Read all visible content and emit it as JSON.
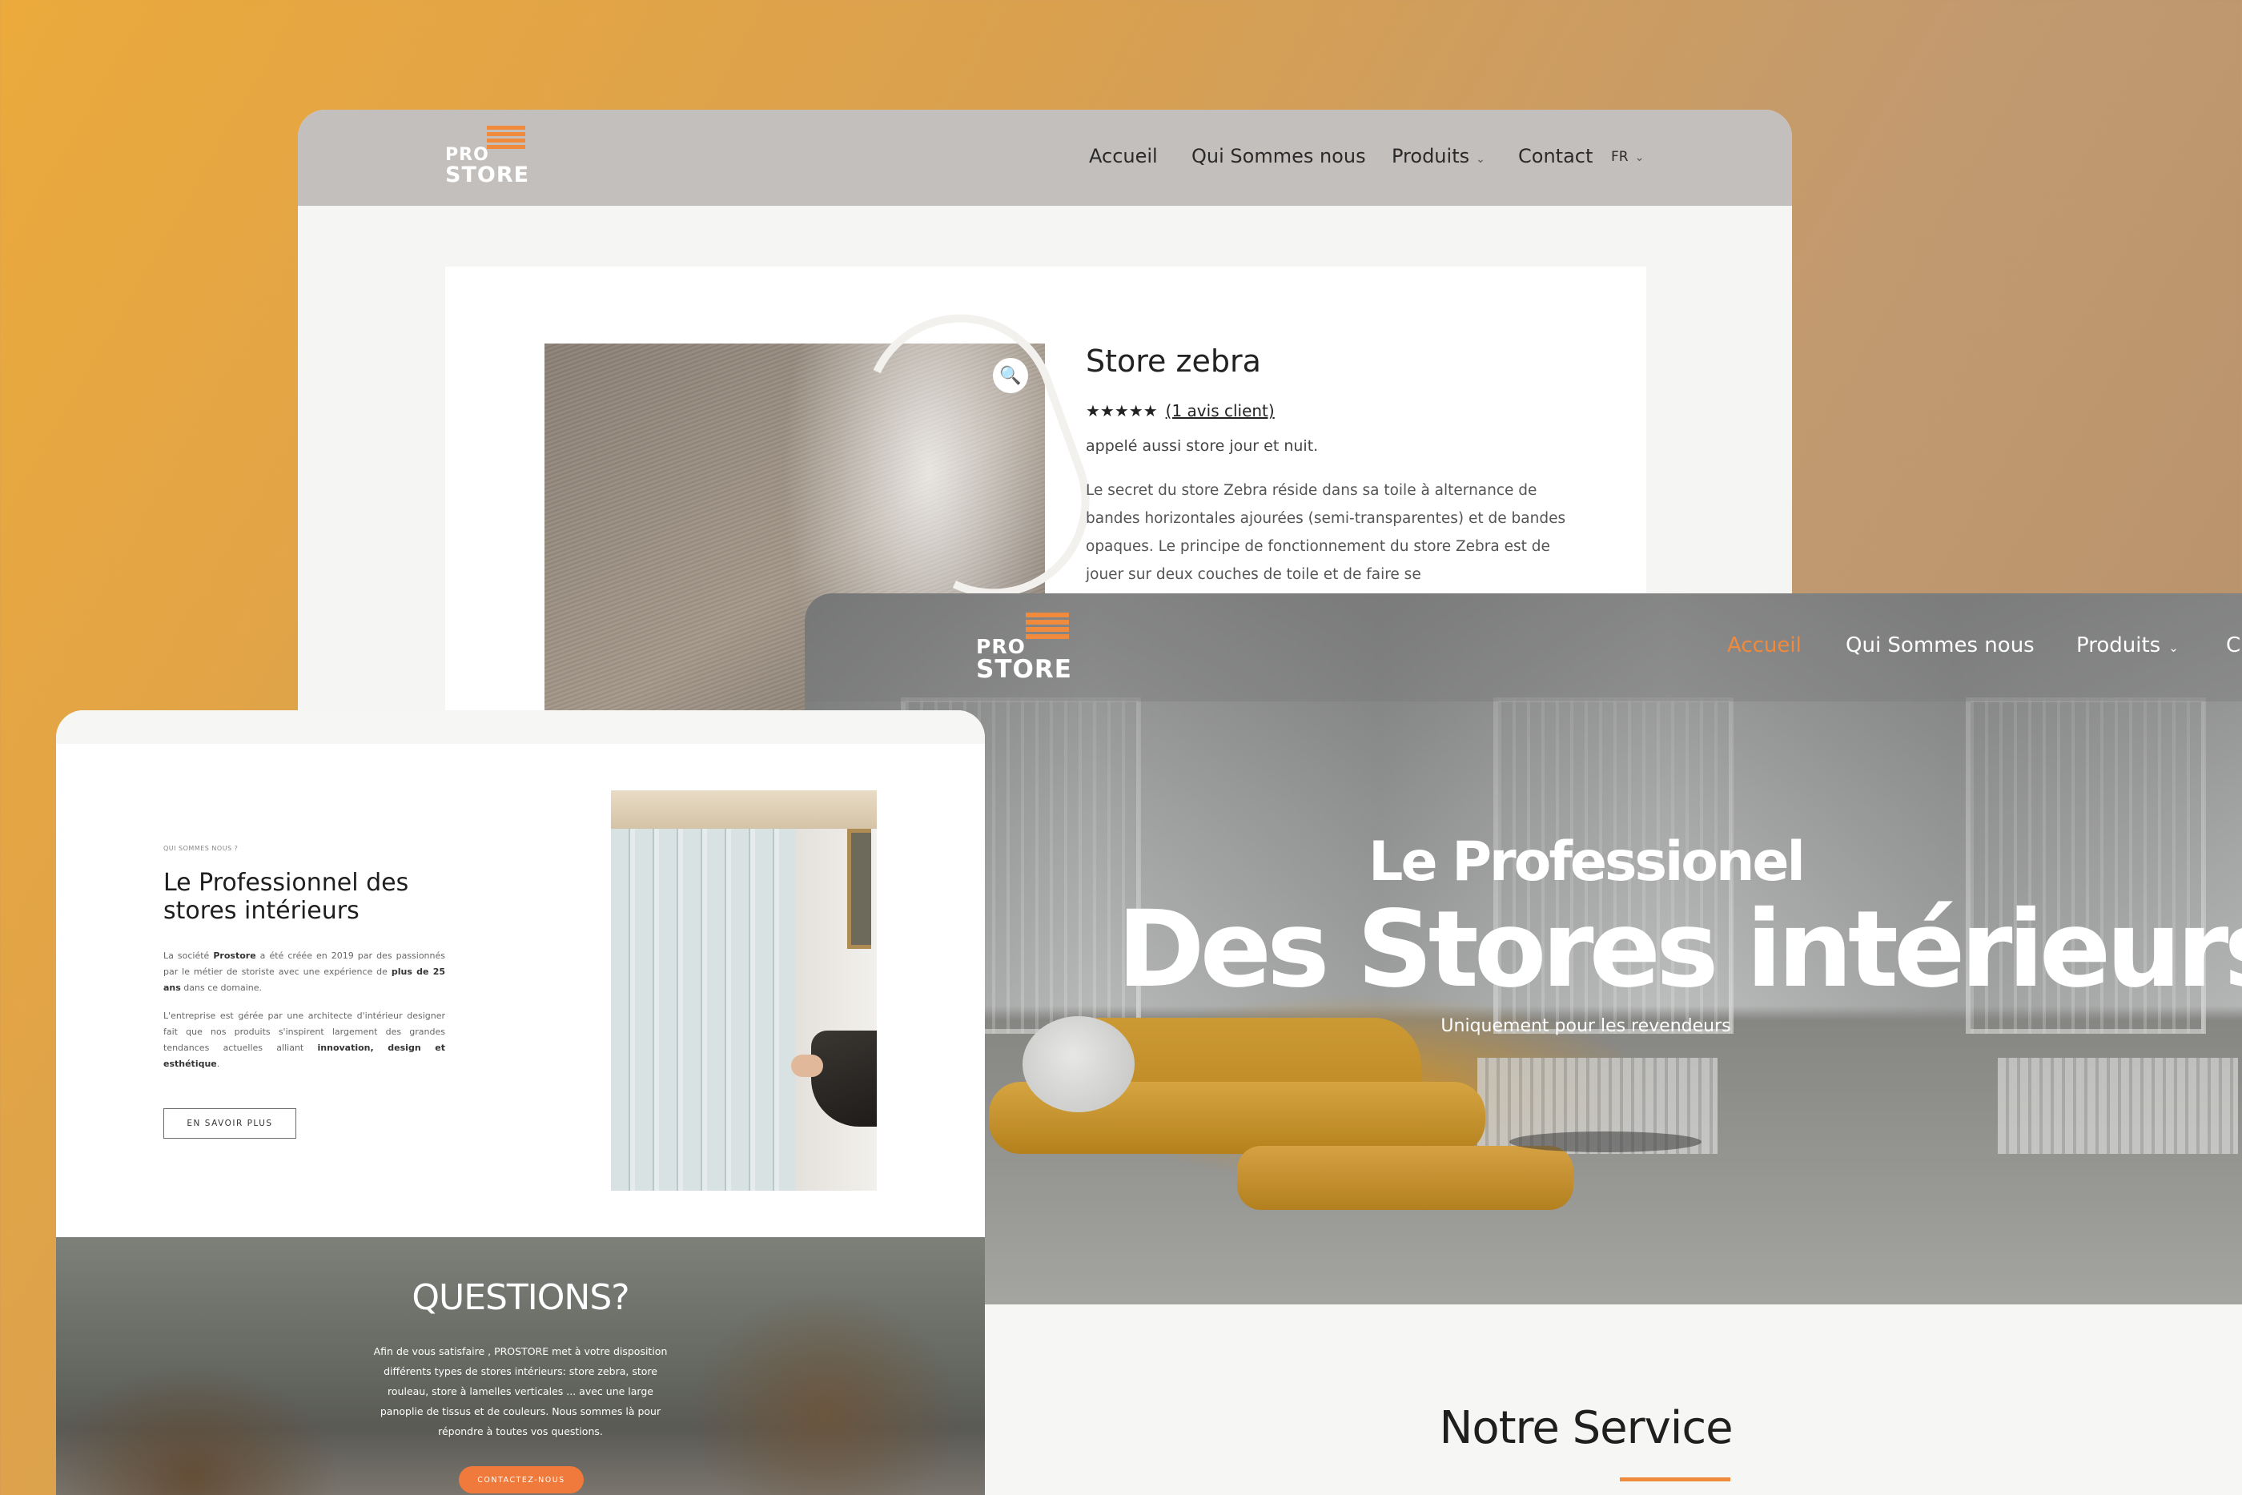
{
  "brand": {
    "logo_top": "PRO",
    "logo_bottom": "STORE",
    "accent_color": "#f08a3c"
  },
  "product_window": {
    "nav": {
      "home": "Accueil",
      "about": "Qui Sommes nous",
      "products": "Produits",
      "contact": "Contact",
      "language": "FR"
    },
    "product": {
      "title": "Store zebra",
      "stars": "★★★★★",
      "review_link": "(1 avis client)",
      "subtitle": "appelé aussi store jour et nuit.",
      "description": "Le secret du store Zebra  réside dans sa toile à alternance de bandes horizontales ajourées (semi-transparentes) et de bandes opaques. Le principe de fonctionnement du store Zebra est de jouer sur deux couches de toile et de faire se",
      "zoom_icon": "🔍"
    }
  },
  "about_window": {
    "eyebrow": "QUI SOMMES NOUS ?",
    "heading": "Le Professionnel des stores intérieurs",
    "para1": {
      "a": "La société ",
      "b": "Prostore",
      "c": " a été créée en 2019 par des passionnés par le métier de storiste avec une expérience de ",
      "d": "plus de 25 ans",
      "e": " dans ce domaine."
    },
    "para2": {
      "a": "L'entreprise est gérée par une architecte d'intérieur designer fait que nos produits s'inspirent largement des grandes tendances actuelles alliant ",
      "b": "innovation, design et esthétique",
      "c": "."
    },
    "more_button": "EN SAVOIR PLUS",
    "questions": {
      "title": "QUESTIONS?",
      "text": "Afin de vous satisfaire , PROSTORE met à votre disposition différents types de stores intérieurs: store zebra, store rouleau, store à lamelles verticales ... avec une large panoplie de tissus et de couleurs. Nous sommes là pour répondre à toutes vos questions.",
      "button": "CONTACTEZ-NOUS"
    }
  },
  "home_window": {
    "nav": {
      "home": "Accueil",
      "about": "Qui Sommes nous",
      "products": "Produits",
      "contact_partial": "C"
    },
    "hero": {
      "small": "Le Professionel",
      "big": "Des Stores intérieurs",
      "sub": "Uniquement pour les revendeurs"
    },
    "section_title": "Notre Service"
  }
}
